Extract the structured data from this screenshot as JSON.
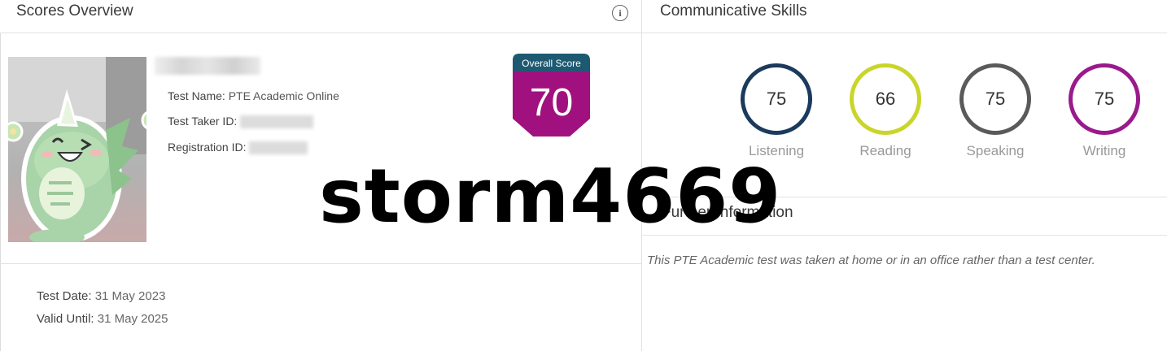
{
  "scores_overview": {
    "title": "Scores Overview",
    "info_icon": "info-icon",
    "fields": {
      "test_name_label": "Test Name:",
      "test_name_value": "PTE Academic Online",
      "test_taker_label": "Test Taker ID:",
      "registration_label": "Registration ID:"
    },
    "overall": {
      "label": "Overall Score",
      "score": "70",
      "header_color": "#1d5a72",
      "body_color": "#a0117f"
    },
    "dates": {
      "test_date_label": "Test Date:",
      "test_date_value": "31 May 2023",
      "valid_until_label": "Valid Until:",
      "valid_until_value": "31 May 2025"
    }
  },
  "communicative_skills": {
    "title": "Communicative Skills",
    "skills": [
      {
        "name": "Listening",
        "score": "75",
        "color": "#1b3a5c"
      },
      {
        "name": "Reading",
        "score": "66",
        "color": "#c9d52a"
      },
      {
        "name": "Speaking",
        "score": "75",
        "color": "#5a5a5a"
      },
      {
        "name": "Writing",
        "score": "75",
        "color": "#9a1a8c"
      }
    ]
  },
  "further_information": {
    "title": "Further Information",
    "text": "This PTE Academic test was taken at home or in an office rather than a test center."
  },
  "watermark": "storm4669"
}
